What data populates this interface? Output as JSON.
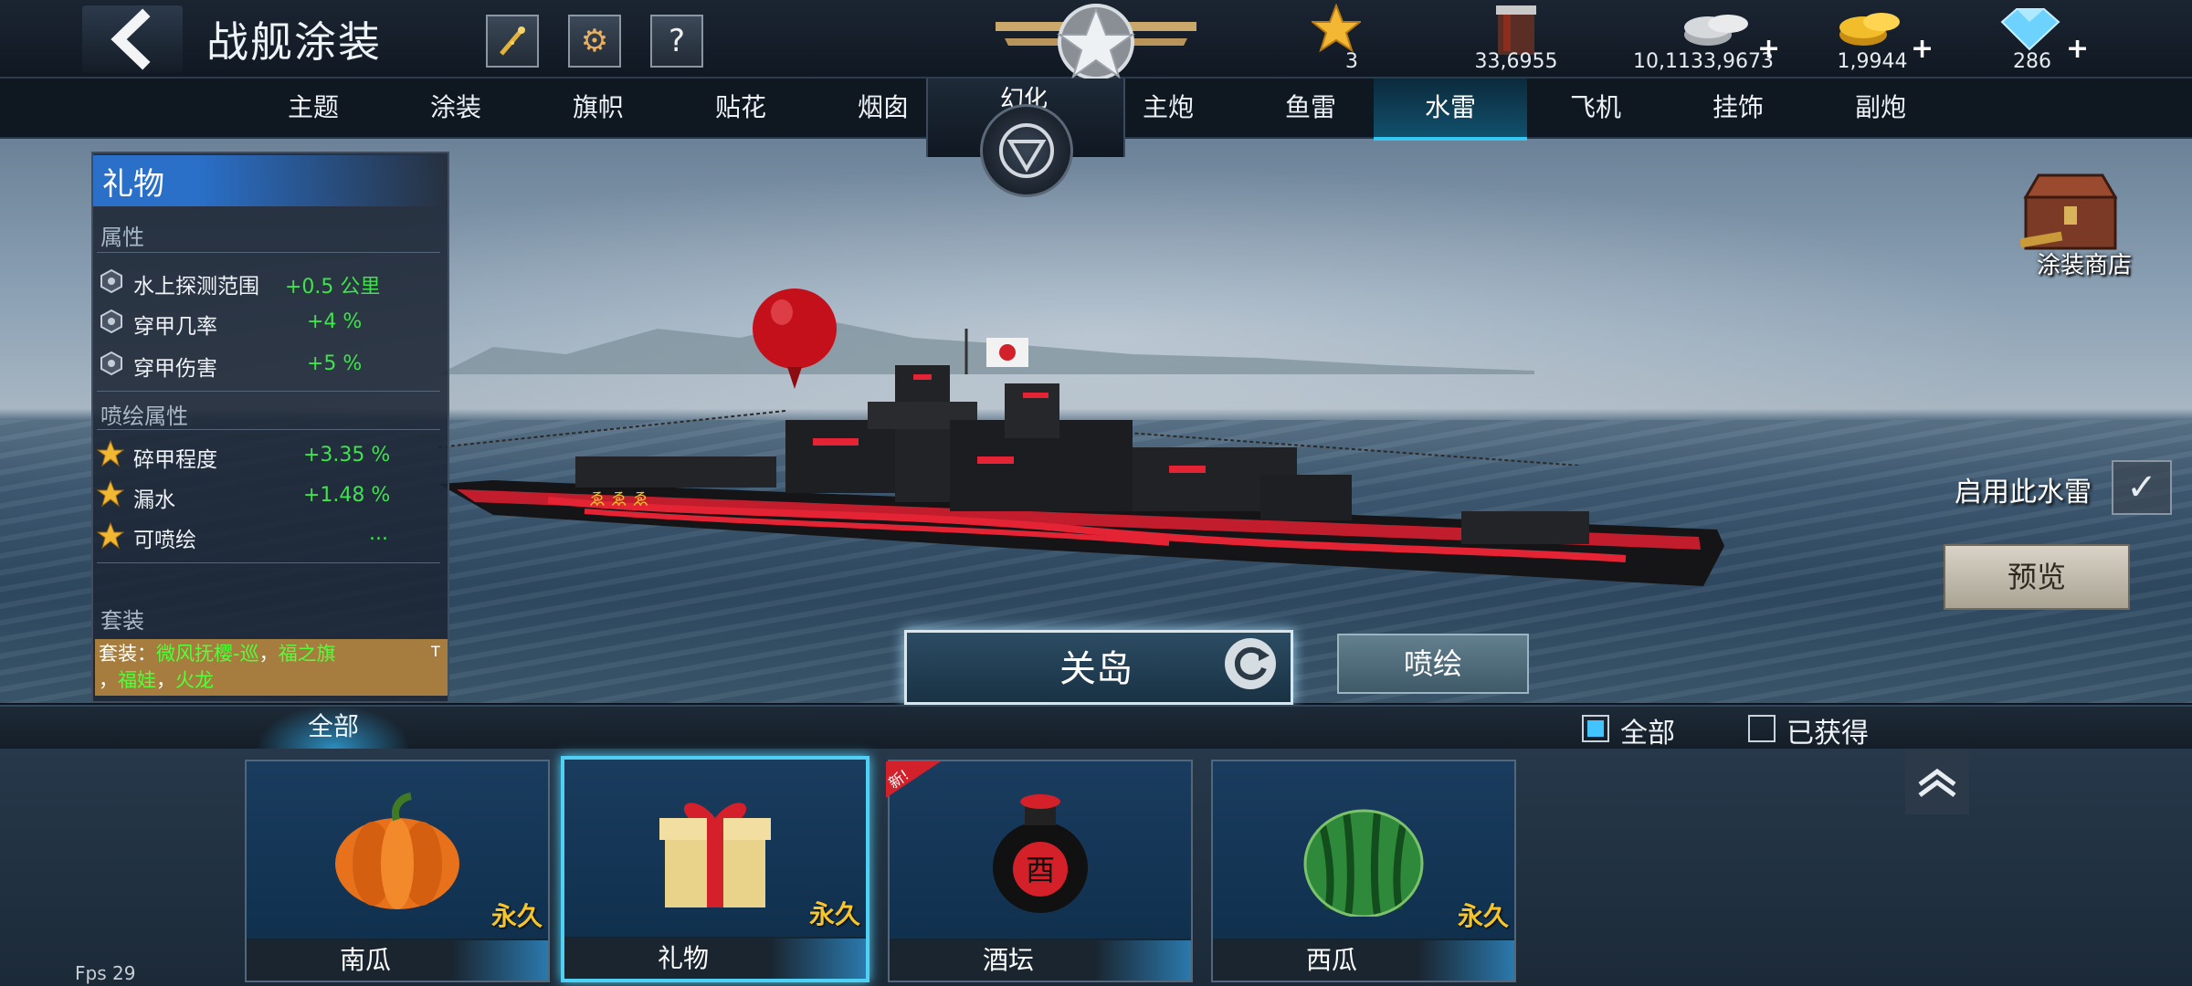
{
  "header": {
    "title": "战舰涂装",
    "resources": [
      {
        "icon": "star-rank-icon",
        "value": "3"
      },
      {
        "icon": "paint-bucket-icon",
        "value": "33,6955"
      },
      {
        "icon": "silver-coins-icon",
        "value": "10,1133,9673",
        "plus": "+"
      },
      {
        "icon": "gold-coins-icon",
        "value": "1,9944",
        "plus": "+"
      },
      {
        "icon": "diamond-icon",
        "value": "286",
        "plus": "+"
      }
    ]
  },
  "tabs": {
    "left": [
      "主题",
      "涂装",
      "旗帜",
      "贴花",
      "烟囱"
    ],
    "center": "幻化",
    "right": [
      "主炮",
      "鱼雷",
      "水雷",
      "飞机",
      "挂饰",
      "副炮"
    ],
    "active": "水雷"
  },
  "info_panel": {
    "title": "礼物",
    "section_attributes": "属性",
    "attributes": [
      {
        "name": "水上探测范围",
        "value": "+0.5 公里"
      },
      {
        "name": "穿甲几率",
        "value": "+4 %"
      },
      {
        "name": "穿甲伤害",
        "value": "+5 %"
      }
    ],
    "section_spray": "喷绘属性",
    "spray_attributes": [
      {
        "name": "碎甲程度",
        "value": "+3.35 %"
      },
      {
        "name": "漏水",
        "value": "+1.48 %"
      },
      {
        "name": "可喷绘",
        "value": "..."
      }
    ],
    "section_set": "套装",
    "set_prefix": "套装：",
    "set_items": [
      "微风抚樱-巡",
      "福之旗",
      "福娃",
      "火龙"
    ],
    "set_sep": "，",
    "set_corner": "T"
  },
  "right_controls": {
    "shop_label": "涂装商店",
    "enable_label": "启用此水雷",
    "enable_checked": "✓",
    "preview_label": "预览"
  },
  "ship": {
    "name": "关岛",
    "spray_label": "喷绘"
  },
  "filter": {
    "tab_all": "全部",
    "check_all": "全部",
    "check_owned": "已获得",
    "check_all_on": true,
    "check_owned_on": false
  },
  "items": [
    {
      "name": "南瓜",
      "duration": "永久",
      "art": "pumpkin-icon",
      "selected": false,
      "new": false
    },
    {
      "name": "礼物",
      "duration": "永久",
      "art": "gift-box-icon",
      "selected": true,
      "new": false
    },
    {
      "name": "酒坛",
      "duration": "",
      "art": "wine-jar-icon",
      "selected": false,
      "new": true,
      "new_label": "新!"
    },
    {
      "name": "西瓜",
      "duration": "永久",
      "art": "watermelon-icon",
      "selected": false,
      "new": false
    }
  ],
  "fps": "Fps 29",
  "colors": {
    "active_tab": "#35c8f2",
    "attr_value": "#3fe34b",
    "permanent": "#f6c52a",
    "info_title": "#2a6fc8",
    "set_box": "#a67d3e"
  }
}
